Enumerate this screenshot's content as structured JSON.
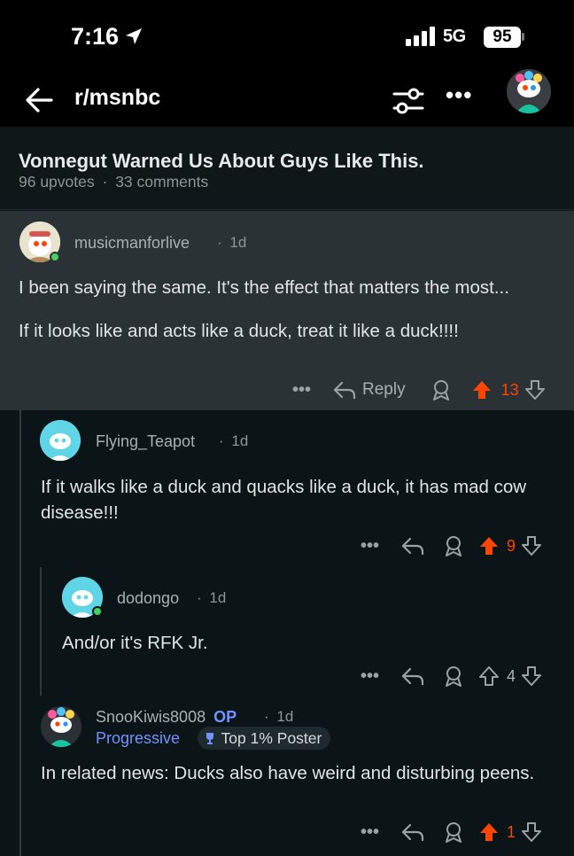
{
  "status_bar": {
    "time": "7:16",
    "network": "5G",
    "battery": "95"
  },
  "nav": {
    "subreddit": "r/msnbc"
  },
  "post": {
    "title": "Vonnegut Warned Us About Guys Like This.",
    "upvotes": "96 upvotes",
    "comments": "33 comments"
  },
  "comments": [
    {
      "user": "musicmanforlive",
      "age": "1d",
      "paragraphs": [
        "I been saying the same. It's the effect that matters the most...",
        "If it looks like and acts like a duck, treat it like a duck!!!!"
      ],
      "reply_label": "Reply",
      "score": "13"
    },
    {
      "user": "Flying_Teapot",
      "age": "1d",
      "paragraphs": [
        "If it walks like a duck and quacks like a duck, it has mad cow disease!!!"
      ],
      "score": "9"
    },
    {
      "user": "dodongo",
      "age": "1d",
      "paragraphs": [
        "And/or it's RFK Jr."
      ],
      "score": "4"
    },
    {
      "user": "SnooKiwis8008",
      "op_label": "OP",
      "age": "1d",
      "flair": "Progressive",
      "badge": "Top 1% Poster",
      "paragraphs": [
        "In related news: Ducks also have weird and disturbing peens."
      ],
      "score": "1"
    }
  ],
  "icons": {
    "back": "arrow-left-icon",
    "filter": "sliders-icon",
    "more": "more-dots-icon",
    "reply": "reply-arrow-icon",
    "award": "award-icon",
    "upvote": "upvote-icon",
    "downvote": "downvote-icon"
  },
  "colors": {
    "upvote_active": "#ff4500",
    "op_blue": "#7193ff",
    "online": "#46d160"
  },
  "sep": "·",
  "more_dots": "•••"
}
